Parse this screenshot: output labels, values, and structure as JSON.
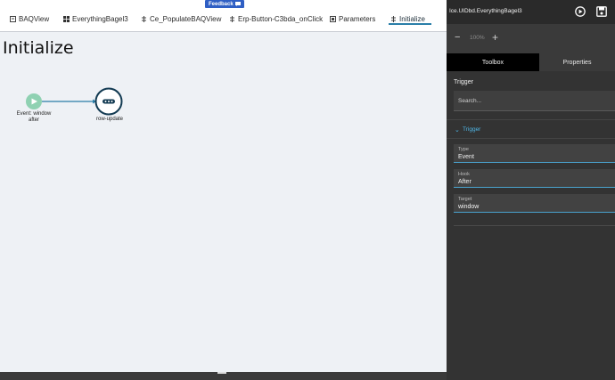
{
  "feedback_label": "Feedback",
  "tabs": [
    {
      "label": "BAQView",
      "icon": "baq-view-icon"
    },
    {
      "label": "EverythingBagel3",
      "icon": "grid-icon"
    },
    {
      "label": "Ce_PopulateBAQView",
      "icon": "event-icon"
    },
    {
      "label": "Erp-Button-C3bda_onClick",
      "icon": "event-icon"
    },
    {
      "label": "Parameters",
      "icon": "parameters-icon"
    },
    {
      "label": "Initialize",
      "icon": "event-icon",
      "active": true
    }
  ],
  "page_title": "Initialize",
  "flow": {
    "start_node": {
      "label_line1": "Event: window",
      "label_line2": "after",
      "icon": "play-icon"
    },
    "end_node": {
      "label": "row-update",
      "icon": "row-update-icon"
    }
  },
  "panel": {
    "title": "Ice.UIDbd.EverythingBagel3",
    "zoom_value": "100%",
    "tabs": {
      "toolbox": "Toolbox",
      "properties": "Properties"
    },
    "heading": "Trigger",
    "search_placeholder": "Search...",
    "section": "Trigger",
    "fields": [
      {
        "label": "Type",
        "value": "Event"
      },
      {
        "label": "Hook",
        "value": "After"
      },
      {
        "label": "Target",
        "value": "window"
      }
    ]
  },
  "colors": {
    "accent": "#2a7ea8",
    "start_node": "#8fd1b2",
    "node_border": "#123a52",
    "section_blue": "#4fb6e6"
  }
}
